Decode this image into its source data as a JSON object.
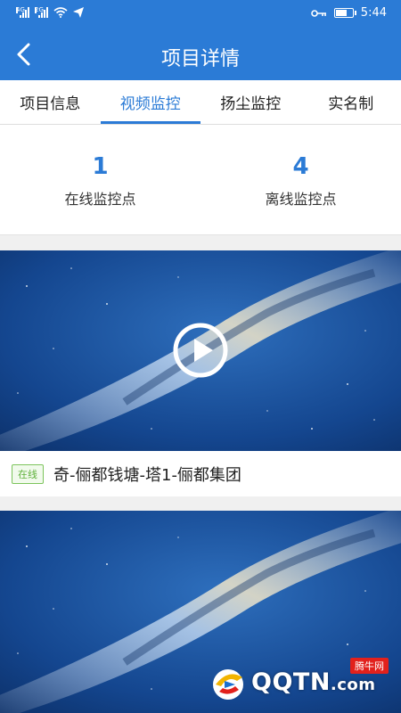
{
  "status_bar": {
    "time": "5:44",
    "net1": "4G",
    "net2": "2G",
    "battery_level": 0.6
  },
  "nav": {
    "title": "项目详情"
  },
  "tabs": [
    {
      "label": "项目信息",
      "active": false
    },
    {
      "label": "视频监控",
      "active": true
    },
    {
      "label": "扬尘监控",
      "active": false
    },
    {
      "label": "实名制",
      "active": false
    }
  ],
  "stats": {
    "online": {
      "count": "1",
      "label": "在线监控点"
    },
    "offline": {
      "count": "4",
      "label": "离线监控点"
    }
  },
  "cameras": [
    {
      "status": "在线",
      "name": "奇-俪都钱塘-塔1-俪都集团"
    }
  ],
  "watermark": {
    "text": "QQTN",
    "suffix": ".com",
    "tag": "腾牛网"
  },
  "colors": {
    "primary": "#2b7bd6",
    "online": "#5fb13b"
  },
  "icons": {
    "back": "chevron-left-icon",
    "play": "play-icon",
    "key": "key-icon",
    "wifi": "wifi-icon",
    "send": "send-icon"
  }
}
